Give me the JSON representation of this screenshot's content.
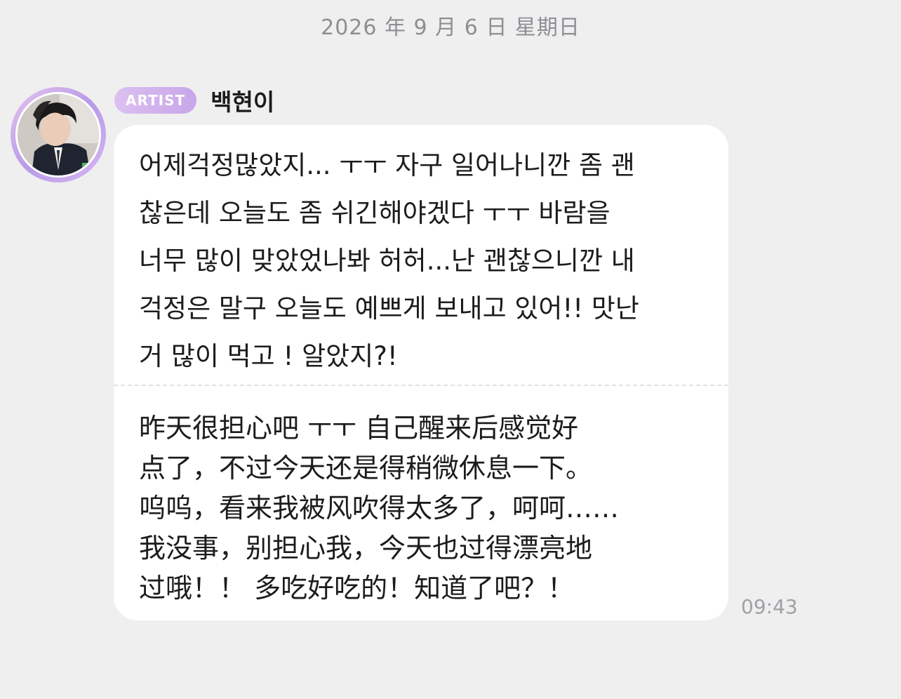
{
  "date_header": "2026 年 9 月 6 日 星期日",
  "sender": {
    "badge": "ARTIST",
    "name": "백현이"
  },
  "message": {
    "original": "어제걱정많았지... ㅜㅜ 자구 일어나니깐 좀 괜\n찮은데 오늘도 좀 쉬긴해야겠다 ㅜㅜ 바람을\n너무 많이 맞았었나봐 허허...난 괜찮으니깐 내\n걱정은 말구 오늘도 예쁘게 보내고 있어!! 맛난\n거 많이 먹고 ! 알았지?!",
    "translation": "昨天很担心吧      ㅜㅜ 自己醒来后感觉好\n点了，不过今天还是得稍微休息一下。\n呜呜，看来我被风吹得太多了，呵呵……\n我没事，别担心我，今天也过得漂亮地\n过哦！！ 多吃好吃的！知道了吧？！",
    "time": "09:43"
  },
  "colors": {
    "background": "#efeff0",
    "bubble": "#ffffff",
    "badge_start": "#dcc0ef",
    "badge_end": "#c7a6ea",
    "avatar_ring": "#c9a8ec"
  }
}
